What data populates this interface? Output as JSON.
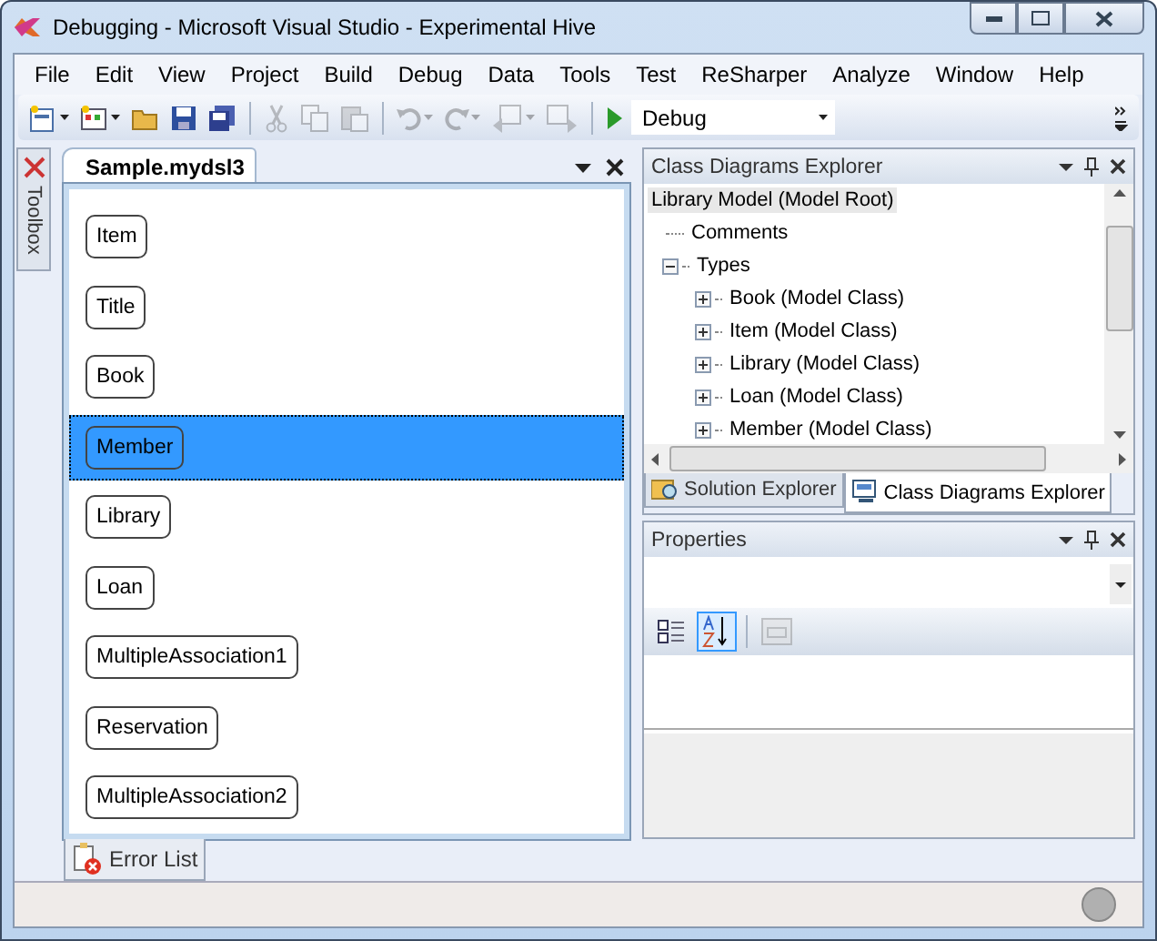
{
  "window": {
    "title": "Debugging - Microsoft Visual Studio - Experimental Hive"
  },
  "menu": [
    "File",
    "Edit",
    "View",
    "Project",
    "Build",
    "Debug",
    "Data",
    "Tools",
    "Test",
    "ReSharper",
    "Analyze",
    "Window",
    "Help"
  ],
  "toolbar": [
    [
      {
        "kind": "new-project",
        "disabled": false,
        "dropdown": true
      },
      {
        "kind": "add-item",
        "disabled": false,
        "dropdown": true
      },
      {
        "kind": "open",
        "disabled": false,
        "dropdown": false
      },
      {
        "kind": "save",
        "disabled": false,
        "dropdown": false
      },
      {
        "kind": "save-all",
        "disabled": false,
        "dropdown": false
      }
    ],
    [
      {
        "kind": "cut",
        "disabled": true,
        "dropdown": false
      },
      {
        "kind": "copy",
        "disabled": true,
        "dropdown": false
      },
      {
        "kind": "paste",
        "disabled": true,
        "dropdown": false
      }
    ],
    [
      {
        "kind": "undo",
        "disabled": true,
        "dropdown": true
      },
      {
        "kind": "redo",
        "disabled": true,
        "dropdown": true
      },
      {
        "kind": "nav-back",
        "disabled": true,
        "dropdown": true
      },
      {
        "kind": "nav-forward",
        "disabled": true,
        "dropdown": false
      }
    ],
    [
      {
        "kind": "start",
        "disabled": false,
        "dropdown": false
      }
    ]
  ],
  "configuration": "Debug",
  "toolbox": {
    "label": "Toolbox"
  },
  "editor": {
    "tab": "Sample.mydsl3",
    "shapes": [
      {
        "label": "Item",
        "selected": false
      },
      {
        "label": "Title",
        "selected": false
      },
      {
        "label": "Book",
        "selected": false
      },
      {
        "label": "Member",
        "selected": true
      },
      {
        "label": "Library",
        "selected": false
      },
      {
        "label": "Loan",
        "selected": false
      },
      {
        "label": "MultipleAssociation1",
        "selected": false
      },
      {
        "label": "Reservation",
        "selected": false
      },
      {
        "label": "MultipleAssociation2",
        "selected": false
      }
    ]
  },
  "explorer": {
    "title": "Class Diagrams Explorer",
    "tree": [
      {
        "label": "Library Model (Model Root)",
        "selected": true,
        "children": [
          {
            "label": "Comments",
            "selected": false
          },
          {
            "label": "Types",
            "selected": false,
            "expanded": true,
            "children": [
              {
                "label": "Book (Model Class)",
                "selected": false,
                "expanded": false
              },
              {
                "label": "Item (Model Class)",
                "selected": false,
                "expanded": false
              },
              {
                "label": "Library (Model Class)",
                "selected": false,
                "expanded": false
              },
              {
                "label": "Loan (Model Class)",
                "selected": false,
                "expanded": false
              },
              {
                "label": "Member (Model Class)",
                "selected": false,
                "expanded": false
              }
            ]
          }
        ]
      }
    ],
    "tabs": [
      {
        "label": "Solution Explorer",
        "kind": "solution",
        "selected": false
      },
      {
        "label": "Class Diagrams Explorer",
        "kind": "class",
        "selected": true
      }
    ]
  },
  "properties": {
    "title": "Properties",
    "buttons": [
      {
        "kind": "categorized",
        "selected": false,
        "disabled": false
      },
      {
        "kind": "alphabetical",
        "selected": true,
        "disabled": false
      },
      {
        "kind": "pages",
        "selected": false,
        "disabled": true
      }
    ]
  },
  "bottom_tabs": [
    {
      "label": "Error List"
    }
  ]
}
